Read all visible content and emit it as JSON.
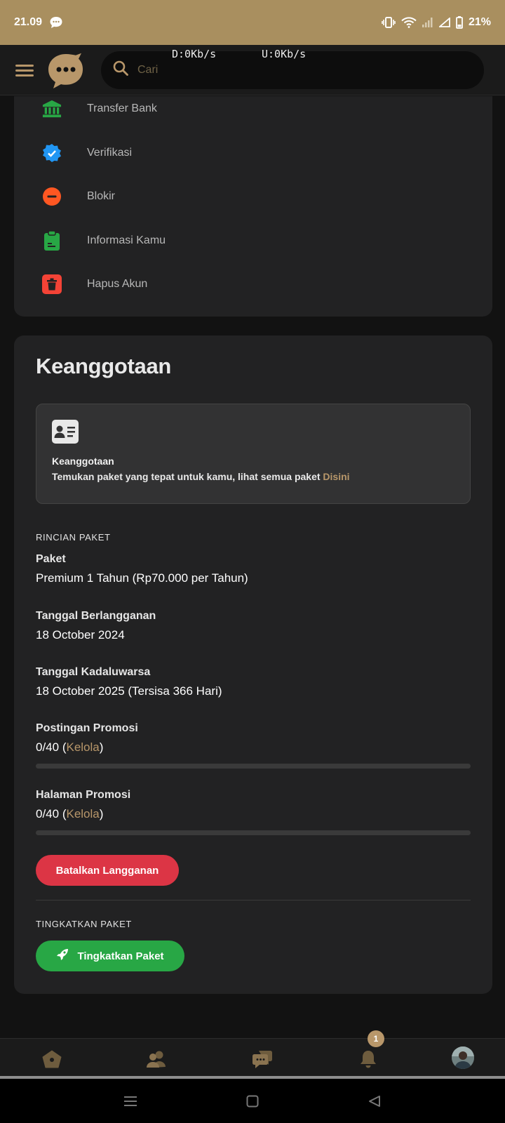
{
  "status_bar": {
    "time": "21.09",
    "battery": "21%"
  },
  "network": {
    "download": "D:0Kb/s",
    "upload": "U:0Kb/s"
  },
  "search": {
    "placeholder": "Cari"
  },
  "settings_menu": [
    {
      "label": "Transfer Bank",
      "icon": "bank-icon",
      "color": "#28a745"
    },
    {
      "label": "Verifikasi",
      "icon": "verified-badge-icon",
      "color": "#2196f3"
    },
    {
      "label": "Blokir",
      "icon": "block-icon",
      "color": "#ff5722"
    },
    {
      "label": "Informasi Kamu",
      "icon": "clipboard-icon",
      "color": "#28a745"
    },
    {
      "label": "Hapus Akun",
      "icon": "trash-icon",
      "color": "#f44336"
    }
  ],
  "membership": {
    "title": "Keanggotaan",
    "info_title": "Keanggotaan",
    "info_text": "Temukan paket yang tepat untuk kamu, lihat semua paket ",
    "info_link": "Disini",
    "details_label": "RINCIAN PAKET",
    "package_label": "Paket",
    "package_value": "Premium 1 Tahun (Rp70.000 per Tahun)",
    "subscribed_label": "Tanggal Berlangganan",
    "subscribed_value": "18 October 2024",
    "expiry_label": "Tanggal Kadaluwarsa",
    "expiry_value": "18 October 2025 (Tersisa 366 Hari)",
    "promo_posts_label": "Postingan Promosi",
    "promo_posts_count": "0/40",
    "promo_posts_progress": 0,
    "promo_pages_label": "Halaman Promosi",
    "promo_pages_count": "0/40",
    "promo_pages_progress": 0,
    "manage_link": "Kelola",
    "cancel_button": "Batalkan Langganan",
    "upgrade_label": "TINGKATKAN PAKET",
    "upgrade_button": "Tingkatkan Paket"
  },
  "bottom_nav": {
    "notification_count": "1"
  },
  "colors": {
    "accent": "#b8976a",
    "status_bar": "#a98f5f",
    "danger": "#dc3545",
    "success": "#28a745"
  }
}
